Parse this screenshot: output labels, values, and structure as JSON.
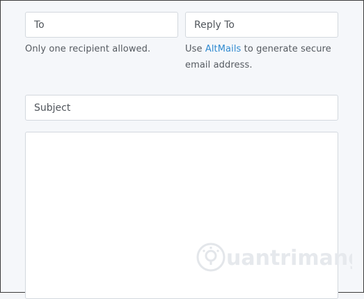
{
  "form": {
    "to": {
      "placeholder": "To",
      "value": ""
    },
    "to_help": "Only one recipient allowed.",
    "reply_to": {
      "placeholder": "Reply To",
      "value": ""
    },
    "reply_help_prefix": "Use ",
    "reply_help_link": "AltMails",
    "reply_help_suffix": " to generate secure email address.",
    "subject": {
      "placeholder": "Subject",
      "value": ""
    },
    "message": {
      "value": ""
    }
  },
  "watermark": {
    "text": "uantrimang",
    "icon": "lightbulb-icon"
  },
  "colors": {
    "link": "#2f8ad0",
    "border": "#d3d8de",
    "background": "#f5f7fa"
  }
}
